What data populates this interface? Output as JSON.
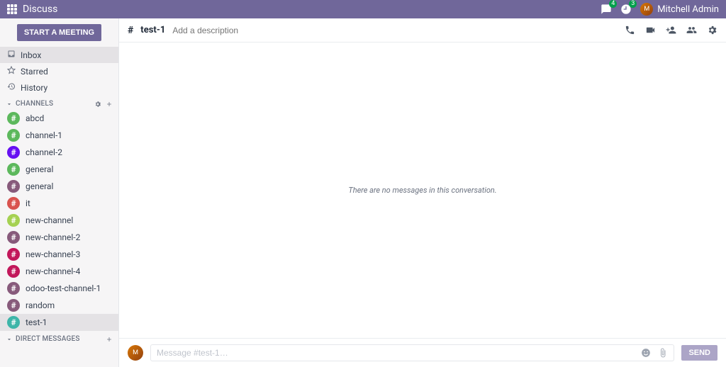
{
  "navbar": {
    "title": "Discuss",
    "messages_badge": "4",
    "activities_badge": "3",
    "user_name": "Mitchell Admin"
  },
  "sidebar": {
    "start_meeting_label": "START A MEETING",
    "mailboxes": [
      {
        "icon": "inbox",
        "label": "Inbox",
        "active": true
      },
      {
        "icon": "star",
        "label": "Starred",
        "active": false
      },
      {
        "icon": "history",
        "label": "History",
        "active": false
      }
    ],
    "channels_header": "CHANNELS",
    "channels": [
      {
        "name": "abcd",
        "color": "c-green"
      },
      {
        "name": "channel-1",
        "color": "c-green"
      },
      {
        "name": "channel-2",
        "color": "c-indigo"
      },
      {
        "name": "general",
        "color": "c-green"
      },
      {
        "name": "general",
        "color": "c-purple"
      },
      {
        "name": "it",
        "color": "c-red"
      },
      {
        "name": "new-channel",
        "color": "c-lime"
      },
      {
        "name": "new-channel-2",
        "color": "c-purple"
      },
      {
        "name": "new-channel-3",
        "color": "c-magenta"
      },
      {
        "name": "new-channel-4",
        "color": "c-magenta"
      },
      {
        "name": "odoo-test-channel-1",
        "color": "c-purple"
      },
      {
        "name": "random",
        "color": "c-purple"
      },
      {
        "name": "test-1",
        "color": "c-teal",
        "active": true
      }
    ],
    "dm_header": "DIRECT MESSAGES"
  },
  "thread": {
    "hash": "#",
    "name": "test-1",
    "description_placeholder": "Add a description",
    "empty_text": "There are no messages in this conversation."
  },
  "composer": {
    "placeholder": "Message #test-1…",
    "send_label": "SEND"
  }
}
